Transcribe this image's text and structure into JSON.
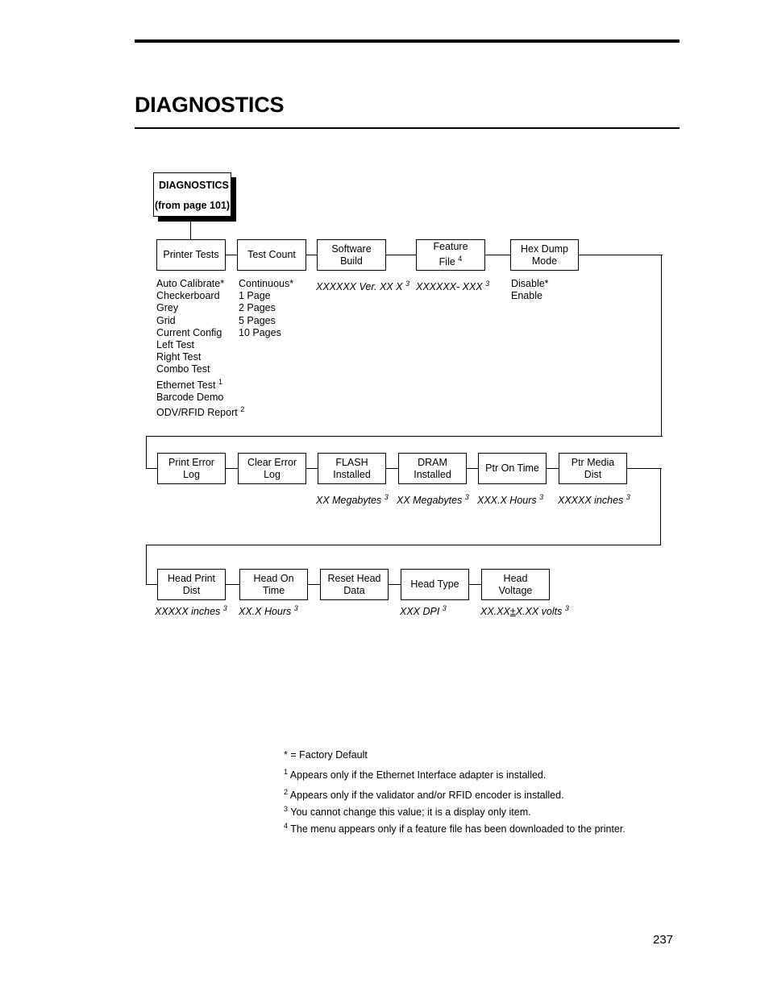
{
  "page": {
    "title": "DIAGNOSTICS",
    "number": "237"
  },
  "root": {
    "label": "DIAGNOSTICS",
    "sublabel": "(from page 101)"
  },
  "rows": [
    {
      "nodes": [
        {
          "label": "Printer Tests"
        },
        {
          "label": "Test Count"
        },
        {
          "label": "Software\nBuild"
        },
        {
          "label": "Feature\nFile ⁴"
        },
        {
          "label": "Hex Dump\nMode"
        }
      ]
    },
    {
      "nodes": [
        {
          "label": "Print Error\nLog"
        },
        {
          "label": "Clear Error\nLog"
        },
        {
          "label": "FLASH\nInstalled"
        },
        {
          "label": "DRAM\nInstalled"
        },
        {
          "label": "Ptr On Time"
        },
        {
          "label": "Ptr Media\nDist"
        }
      ]
    },
    {
      "nodes": [
        {
          "label": "Head Print\nDist"
        },
        {
          "label": "Head On\nTime"
        },
        {
          "label": "Reset Head\nData"
        },
        {
          "label": "Head Type"
        },
        {
          "label": "Head\nVoltage"
        }
      ]
    }
  ],
  "printer_tests_options": "Auto Calibrate*\nCheckerboard\nGrey\nGrid\nCurrent Config\nLeft Test\nRight Test\nCombo Test\nEthernet Test ¹\nBarcode Demo\nODV/RFID Report ²",
  "test_count_options": "Continuous*\n1 Page\n2 Pages\n5 Pages\n10 Pages",
  "hex_dump_options": "Disable*\nEnable",
  "values": {
    "software_build": "XXXXXX Ver. XX X ³",
    "feature_file": "XXXXXX- XXX ³",
    "flash_installed": "XX Megabytes ³",
    "dram_installed": "XX Megabytes ³",
    "ptr_on_time": "XXX.X Hours ³",
    "ptr_media_dist": "XXXXX inches ³",
    "head_print_dist": "XXXXX inches ³",
    "head_on_time": "XX.X Hours ³",
    "head_type": "XXX DPI ³",
    "head_voltage": "XX.XX±X.XX volts ³"
  },
  "footnotes": {
    "factory_default": "* = Factory Default",
    "note1": "¹ Appears only if the Ethernet Interface adapter is installed.",
    "note2": "² Appears only if the validator and/or RFID encoder is installed.",
    "note3": "³ You cannot change this value; it is a display only item.",
    "note4": "⁴ The menu appears only if a feature file has been downloaded to the printer."
  }
}
